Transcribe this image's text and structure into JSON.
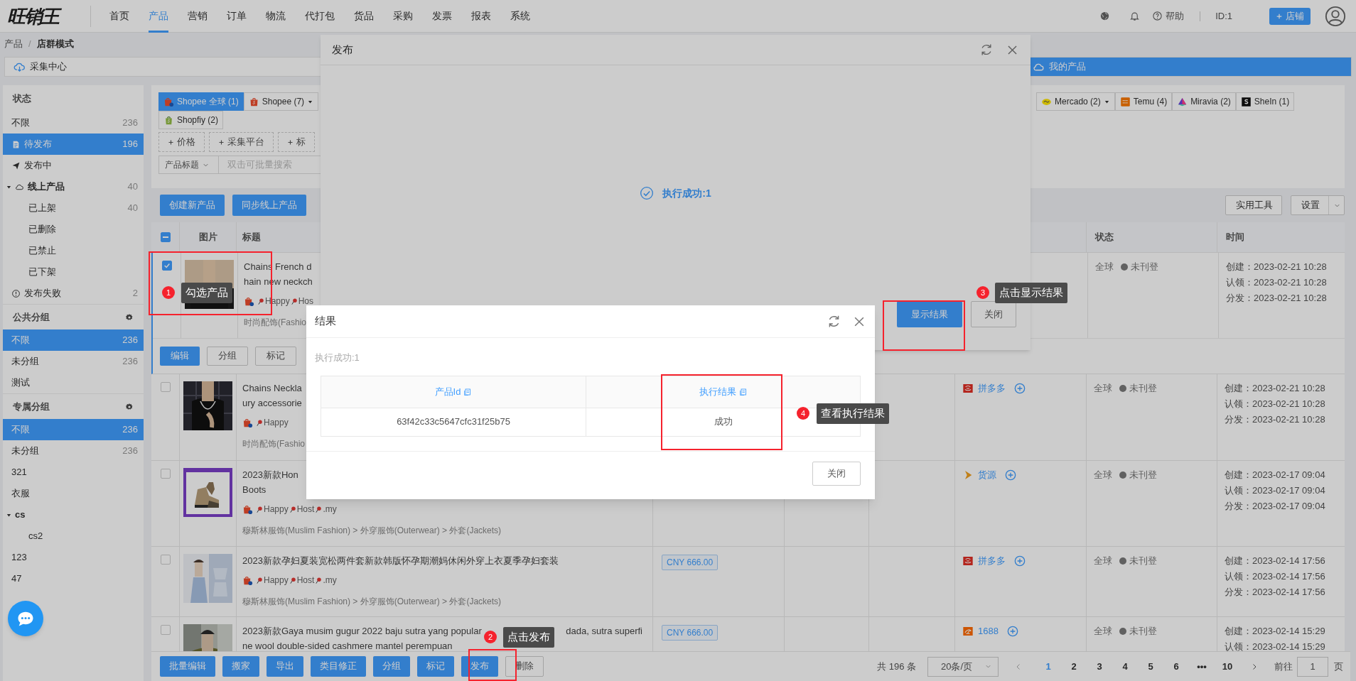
{
  "header": {
    "logo": "旺销王",
    "nav": [
      {
        "label": "首页",
        "selected": false
      },
      {
        "label": "产品",
        "selected": true
      },
      {
        "label": "营销",
        "selected": false
      },
      {
        "label": "订单",
        "selected": false
      },
      {
        "label": "物流",
        "selected": false
      },
      {
        "label": "代打包",
        "selected": false
      },
      {
        "label": "货品",
        "selected": false
      },
      {
        "label": "采购",
        "selected": false
      },
      {
        "label": "发票",
        "selected": false
      },
      {
        "label": "报表",
        "selected": false
      },
      {
        "label": "系统",
        "selected": false
      }
    ],
    "help": "帮助",
    "user_id": "ID:1",
    "shop_button": "店铺"
  },
  "breadcrumb": {
    "items": [
      "产品",
      "店群模式"
    ],
    "separator": "/"
  },
  "view_tabs": [
    {
      "label": "采集中心",
      "selected": false
    },
    {
      "label": "我的产品",
      "selected": true
    }
  ],
  "sidebar": [
    {
      "title": "状态",
      "settings": false,
      "items": [
        {
          "label": "不限",
          "count": "236",
          "selected": false
        },
        {
          "label": "待发布",
          "count": "196",
          "selected": true,
          "kind": "pending"
        },
        {
          "label": "发布中",
          "selected": false,
          "kind": "publishing"
        },
        {
          "label": "线上产品",
          "count": "40",
          "selected": false,
          "kind": "online",
          "expanded": true,
          "children": [
            {
              "label": "已上架",
              "count": "40",
              "selected": false
            },
            {
              "label": "已删除",
              "selected": false
            },
            {
              "label": "已禁止",
              "selected": false
            },
            {
              "label": "已下架",
              "selected": false
            }
          ]
        },
        {
          "label": "发布失败",
          "count": "2",
          "selected": false,
          "kind": "failed"
        }
      ]
    },
    {
      "title": "公共分组",
      "settings": true,
      "items": [
        {
          "label": "不限",
          "count": "236",
          "selected": true
        },
        {
          "label": "未分组",
          "count": "236",
          "selected": false
        },
        {
          "label": "测试",
          "selected": false
        }
      ]
    },
    {
      "title": "专属分组",
      "settings": true,
      "items": [
        {
          "label": "不限",
          "count": "236",
          "selected": true
        },
        {
          "label": "未分组",
          "count": "236",
          "selected": false
        },
        {
          "label": "321",
          "selected": false
        },
        {
          "label": "衣服",
          "selected": false
        },
        {
          "label": "cs",
          "selected": false,
          "expanded": true,
          "children": [
            {
              "label": "cs2",
              "selected": false
            }
          ]
        },
        {
          "label": "123",
          "selected": false
        },
        {
          "label": "47",
          "selected": false
        }
      ]
    }
  ],
  "platform_tabs": {
    "row_1_left": [
      {
        "label": "Shopee 全球 (1)",
        "kind": "shopee",
        "selected": true,
        "dropdown": false
      },
      {
        "label": "Shopee (7)",
        "kind": "shopee",
        "selected": false,
        "dropdown": true
      }
    ],
    "row_1_right": [
      {
        "label": "Mercado (2)",
        "kind": "mercado",
        "selected": false,
        "dropdown": true
      },
      {
        "label": "Temu (4)",
        "kind": "temu",
        "selected": false,
        "dropdown": false
      },
      {
        "label": "Miravia (2)",
        "kind": "miravia",
        "selected": false,
        "dropdown": false
      },
      {
        "label": "SheIn (1)",
        "kind": "shein",
        "selected": false,
        "dropdown": false
      }
    ],
    "row_2": [
      {
        "label": "Shopfiy (2)",
        "kind": "shopify",
        "selected": false,
        "dropdown": false
      }
    ]
  },
  "filter_chips": [
    "价格",
    "采集平台",
    "标"
  ],
  "search": {
    "field": "产品标题",
    "placeholder": "双击可批量搜索"
  },
  "toolbar": {
    "left": [
      "创建新产品",
      "同步线上产品"
    ],
    "right": [
      {
        "label": "实用工具",
        "dropdown": false
      },
      {
        "label": "设置",
        "dropdown": true
      }
    ]
  },
  "table": {
    "select_all": {
      "indeterminate": true
    },
    "columns": [
      "图片",
      "标题",
      "状态",
      "时间"
    ],
    "rows": [
      {
        "checked": true,
        "title": [
          "Chains French d",
          "hain new neckch"
        ],
        "tags": [
          "Happy",
          "Hos"
        ],
        "category": "时尚配饰(Fashio",
        "region": "全球",
        "status": "未刊登",
        "times": [
          "创建：2023-02-21 10:28",
          "认领：2023-02-21 10:28",
          "分发：2023-02-21 10:28"
        ],
        "actions": [
          {
            "label": "编辑",
            "primary": true
          },
          {
            "label": "分组",
            "primary": false
          },
          {
            "label": "标记",
            "primary": false
          }
        ]
      },
      {
        "checked": false,
        "title": [
          "Chains Neckla",
          "ury accessorie"
        ],
        "tags": [
          "Happy"
        ],
        "category": "时尚配饰(Fashio",
        "source": {
          "kind": "pdd",
          "label": "拼多多"
        },
        "region": "全球",
        "status": "未刊登",
        "times": [
          "创建：2023-02-21 10:28",
          "认领：2023-02-21 10:28",
          "分发：2023-02-21 10:28"
        ]
      },
      {
        "checked": false,
        "title": [
          "2023新款Hon",
          "Boots"
        ],
        "tags": [
          "Happy",
          "Host",
          ".my"
        ],
        "category": "穆斯林服饰(Muslim Fashion) > 外穿服饰(Outerwear) > 外套(Jackets)",
        "source": {
          "kind": "supply",
          "label": "货源"
        },
        "region": "全球",
        "status": "未刊登",
        "times": [
          "创建：2023-02-17 09:04",
          "认领：2023-02-17 09:04",
          "分发：2023-02-17 09:04"
        ]
      },
      {
        "checked": false,
        "title": [
          "2023新款孕妇夏装宽松两件套新款韩版怀孕期潮妈休闲外穿上衣夏季孕妇套装"
        ],
        "tags": [
          "Happy",
          "Host",
          ".my"
        ],
        "category": "穆斯林服饰(Muslim Fashion) > 外穿服饰(Outerwear) > 外套(Jackets)",
        "price": "CNY 666.00",
        "source": {
          "kind": "pdd",
          "label": "拼多多"
        },
        "region": "全球",
        "status": "未刊登",
        "times": [
          "创建：2023-02-14 17:56",
          "认领：2023-02-14 17:56",
          "分发：2023-02-14 17:56"
        ]
      },
      {
        "checked": false,
        "title": [
          [
            "2023新款Gaya musim gugur 2022 baju sutra yang popular",
            "dada, sutra superfi"
          ],
          "ne wool double-sided cashmere mantel perempuan"
        ],
        "price": "CNY 666.00",
        "source": {
          "kind": "wholesale",
          "label": "1688"
        },
        "region": "全球",
        "status": "未刊登",
        "times": [
          "创建：2023-02-14 15:29",
          "认领：2023-02-14 15:29"
        ]
      }
    ]
  },
  "bulk_actions": [
    {
      "label": "批量编辑",
      "primary": true
    },
    {
      "label": "搬家",
      "primary": true
    },
    {
      "label": "导出",
      "primary": true
    },
    {
      "label": "类目修正",
      "primary": true
    },
    {
      "label": "分组",
      "primary": true
    },
    {
      "label": "标记",
      "primary": true
    },
    {
      "label": "发布",
      "primary": true
    },
    {
      "label": "删除",
      "primary": false
    }
  ],
  "pagination": {
    "total": "共 196 条",
    "page_size": "20条/页",
    "pages": [
      {
        "label": "1",
        "selected": true
      },
      {
        "label": "2",
        "selected": false
      },
      {
        "label": "3",
        "selected": false
      },
      {
        "label": "4",
        "selected": false
      },
      {
        "label": "5",
        "selected": false
      },
      {
        "label": "6",
        "selected": false
      },
      {
        "label": "•••",
        "selected": false
      },
      {
        "label": "10",
        "selected": false
      }
    ],
    "goto_label": "前往",
    "goto_value": "1",
    "goto_suffix": "页"
  },
  "publish_dialog": {
    "title": "发布",
    "message": "执行成功:1",
    "buttons": [
      {
        "label": "显示结果",
        "primary": true
      },
      {
        "label": "关闭",
        "primary": false
      }
    ]
  },
  "result_dialog": {
    "title": "结果",
    "summary": "执行成功:1",
    "columns": [
      "产品Id",
      "执行结果"
    ],
    "rows": [
      [
        "63f42c33c5647cfc31f25b75",
        "成功"
      ]
    ],
    "close_button": "关闭"
  },
  "annotations": [
    {
      "number": "1",
      "text": "勾选产品"
    },
    {
      "number": "2",
      "text": "点击发布"
    },
    {
      "number": "3",
      "text": "点击显示结果"
    },
    {
      "number": "4",
      "text": "查看执行结果"
    }
  ]
}
